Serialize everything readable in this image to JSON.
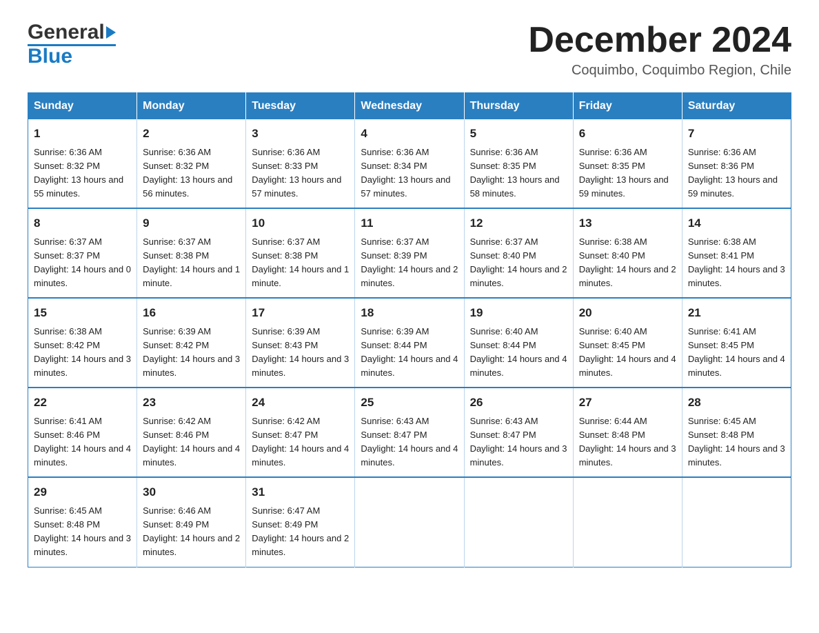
{
  "header": {
    "logo_general": "General",
    "logo_blue": "Blue",
    "month_title": "December 2024",
    "subtitle": "Coquimbo, Coquimbo Region, Chile"
  },
  "days_of_week": [
    "Sunday",
    "Monday",
    "Tuesday",
    "Wednesday",
    "Thursday",
    "Friday",
    "Saturday"
  ],
  "weeks": [
    [
      {
        "day": "1",
        "sunrise": "Sunrise: 6:36 AM",
        "sunset": "Sunset: 8:32 PM",
        "daylight": "Daylight: 13 hours and 55 minutes."
      },
      {
        "day": "2",
        "sunrise": "Sunrise: 6:36 AM",
        "sunset": "Sunset: 8:32 PM",
        "daylight": "Daylight: 13 hours and 56 minutes."
      },
      {
        "day": "3",
        "sunrise": "Sunrise: 6:36 AM",
        "sunset": "Sunset: 8:33 PM",
        "daylight": "Daylight: 13 hours and 57 minutes."
      },
      {
        "day": "4",
        "sunrise": "Sunrise: 6:36 AM",
        "sunset": "Sunset: 8:34 PM",
        "daylight": "Daylight: 13 hours and 57 minutes."
      },
      {
        "day": "5",
        "sunrise": "Sunrise: 6:36 AM",
        "sunset": "Sunset: 8:35 PM",
        "daylight": "Daylight: 13 hours and 58 minutes."
      },
      {
        "day": "6",
        "sunrise": "Sunrise: 6:36 AM",
        "sunset": "Sunset: 8:35 PM",
        "daylight": "Daylight: 13 hours and 59 minutes."
      },
      {
        "day": "7",
        "sunrise": "Sunrise: 6:36 AM",
        "sunset": "Sunset: 8:36 PM",
        "daylight": "Daylight: 13 hours and 59 minutes."
      }
    ],
    [
      {
        "day": "8",
        "sunrise": "Sunrise: 6:37 AM",
        "sunset": "Sunset: 8:37 PM",
        "daylight": "Daylight: 14 hours and 0 minutes."
      },
      {
        "day": "9",
        "sunrise": "Sunrise: 6:37 AM",
        "sunset": "Sunset: 8:38 PM",
        "daylight": "Daylight: 14 hours and 1 minute."
      },
      {
        "day": "10",
        "sunrise": "Sunrise: 6:37 AM",
        "sunset": "Sunset: 8:38 PM",
        "daylight": "Daylight: 14 hours and 1 minute."
      },
      {
        "day": "11",
        "sunrise": "Sunrise: 6:37 AM",
        "sunset": "Sunset: 8:39 PM",
        "daylight": "Daylight: 14 hours and 2 minutes."
      },
      {
        "day": "12",
        "sunrise": "Sunrise: 6:37 AM",
        "sunset": "Sunset: 8:40 PM",
        "daylight": "Daylight: 14 hours and 2 minutes."
      },
      {
        "day": "13",
        "sunrise": "Sunrise: 6:38 AM",
        "sunset": "Sunset: 8:40 PM",
        "daylight": "Daylight: 14 hours and 2 minutes."
      },
      {
        "day": "14",
        "sunrise": "Sunrise: 6:38 AM",
        "sunset": "Sunset: 8:41 PM",
        "daylight": "Daylight: 14 hours and 3 minutes."
      }
    ],
    [
      {
        "day": "15",
        "sunrise": "Sunrise: 6:38 AM",
        "sunset": "Sunset: 8:42 PM",
        "daylight": "Daylight: 14 hours and 3 minutes."
      },
      {
        "day": "16",
        "sunrise": "Sunrise: 6:39 AM",
        "sunset": "Sunset: 8:42 PM",
        "daylight": "Daylight: 14 hours and 3 minutes."
      },
      {
        "day": "17",
        "sunrise": "Sunrise: 6:39 AM",
        "sunset": "Sunset: 8:43 PM",
        "daylight": "Daylight: 14 hours and 3 minutes."
      },
      {
        "day": "18",
        "sunrise": "Sunrise: 6:39 AM",
        "sunset": "Sunset: 8:44 PM",
        "daylight": "Daylight: 14 hours and 4 minutes."
      },
      {
        "day": "19",
        "sunrise": "Sunrise: 6:40 AM",
        "sunset": "Sunset: 8:44 PM",
        "daylight": "Daylight: 14 hours and 4 minutes."
      },
      {
        "day": "20",
        "sunrise": "Sunrise: 6:40 AM",
        "sunset": "Sunset: 8:45 PM",
        "daylight": "Daylight: 14 hours and 4 minutes."
      },
      {
        "day": "21",
        "sunrise": "Sunrise: 6:41 AM",
        "sunset": "Sunset: 8:45 PM",
        "daylight": "Daylight: 14 hours and 4 minutes."
      }
    ],
    [
      {
        "day": "22",
        "sunrise": "Sunrise: 6:41 AM",
        "sunset": "Sunset: 8:46 PM",
        "daylight": "Daylight: 14 hours and 4 minutes."
      },
      {
        "day": "23",
        "sunrise": "Sunrise: 6:42 AM",
        "sunset": "Sunset: 8:46 PM",
        "daylight": "Daylight: 14 hours and 4 minutes."
      },
      {
        "day": "24",
        "sunrise": "Sunrise: 6:42 AM",
        "sunset": "Sunset: 8:47 PM",
        "daylight": "Daylight: 14 hours and 4 minutes."
      },
      {
        "day": "25",
        "sunrise": "Sunrise: 6:43 AM",
        "sunset": "Sunset: 8:47 PM",
        "daylight": "Daylight: 14 hours and 4 minutes."
      },
      {
        "day": "26",
        "sunrise": "Sunrise: 6:43 AM",
        "sunset": "Sunset: 8:47 PM",
        "daylight": "Daylight: 14 hours and 3 minutes."
      },
      {
        "day": "27",
        "sunrise": "Sunrise: 6:44 AM",
        "sunset": "Sunset: 8:48 PM",
        "daylight": "Daylight: 14 hours and 3 minutes."
      },
      {
        "day": "28",
        "sunrise": "Sunrise: 6:45 AM",
        "sunset": "Sunset: 8:48 PM",
        "daylight": "Daylight: 14 hours and 3 minutes."
      }
    ],
    [
      {
        "day": "29",
        "sunrise": "Sunrise: 6:45 AM",
        "sunset": "Sunset: 8:48 PM",
        "daylight": "Daylight: 14 hours and 3 minutes."
      },
      {
        "day": "30",
        "sunrise": "Sunrise: 6:46 AM",
        "sunset": "Sunset: 8:49 PM",
        "daylight": "Daylight: 14 hours and 2 minutes."
      },
      {
        "day": "31",
        "sunrise": "Sunrise: 6:47 AM",
        "sunset": "Sunset: 8:49 PM",
        "daylight": "Daylight: 14 hours and 2 minutes."
      },
      null,
      null,
      null,
      null
    ]
  ]
}
